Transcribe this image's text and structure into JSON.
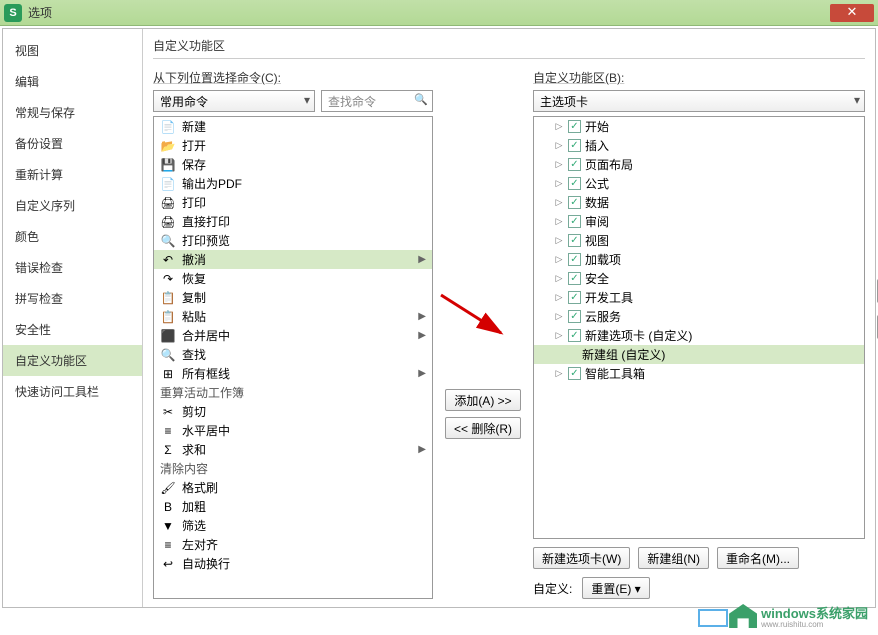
{
  "window": {
    "title": "选项"
  },
  "sidebar": {
    "items": [
      "视图",
      "编辑",
      "常规与保存",
      "备份设置",
      "重新计算",
      "自定义序列",
      "颜色",
      "错误检查",
      "拼写检查",
      "安全性",
      "自定义功能区",
      "快速访问工具栏"
    ],
    "selected_index": 10
  },
  "content": {
    "title": "自定义功能区"
  },
  "left": {
    "label": "从下列位置选择命令(C):",
    "dropdown": "常用命令",
    "search_placeholder": "查找命令",
    "items": [
      {
        "label": "新建"
      },
      {
        "label": "打开"
      },
      {
        "label": "保存"
      },
      {
        "label": "输出为PDF"
      },
      {
        "label": "打印"
      },
      {
        "label": "直接打印"
      },
      {
        "label": "打印预览"
      },
      {
        "label": "撤消",
        "selected": true,
        "submenu": true
      },
      {
        "label": "恢复"
      },
      {
        "label": "复制"
      },
      {
        "label": "粘贴",
        "submenu": true
      },
      {
        "label": "合并居中",
        "submenu": true
      },
      {
        "label": "查找"
      },
      {
        "label": "所有框线",
        "submenu": true
      },
      {
        "label": "重算活动工作簿",
        "header": true
      },
      {
        "label": "剪切"
      },
      {
        "label": "水平居中"
      },
      {
        "label": "求和",
        "submenu": true
      },
      {
        "label": "清除内容",
        "header": true
      },
      {
        "label": "格式刷"
      },
      {
        "label": "加粗"
      },
      {
        "label": "筛选"
      },
      {
        "label": "左对齐"
      },
      {
        "label": "自动换行"
      }
    ]
  },
  "mid": {
    "add": "添加(A) >>",
    "remove": "<< 删除(R)"
  },
  "right": {
    "label": "自定义功能区(B):",
    "dropdown": "主选项卡",
    "tree": [
      {
        "label": "开始",
        "checked": true
      },
      {
        "label": "插入",
        "checked": true
      },
      {
        "label": "页面布局",
        "checked": true
      },
      {
        "label": "公式",
        "checked": true
      },
      {
        "label": "数据",
        "checked": true
      },
      {
        "label": "审阅",
        "checked": true
      },
      {
        "label": "视图",
        "checked": true
      },
      {
        "label": "加载项",
        "checked": true
      },
      {
        "label": "安全",
        "checked": true
      },
      {
        "label": "开发工具",
        "checked": true
      },
      {
        "label": "云服务",
        "checked": true
      },
      {
        "label": "新建选项卡 (自定义)",
        "checked": true,
        "custom": true
      },
      {
        "label": "新建组 (自定义)",
        "selected": true,
        "indent": 2,
        "nocheck": true
      },
      {
        "label": "智能工具箱",
        "checked": true
      }
    ],
    "updown": {
      "up": "▲",
      "down": "▼"
    },
    "footer": {
      "new_tab": "新建选项卡(W)",
      "new_group": "新建组(N)",
      "rename": "重命名(M)...",
      "custom_label": "自定义:",
      "reset": "重置(E) ▾"
    }
  },
  "watermark": {
    "text": "windows系统家园",
    "sub": "www.ruishitu.com"
  }
}
